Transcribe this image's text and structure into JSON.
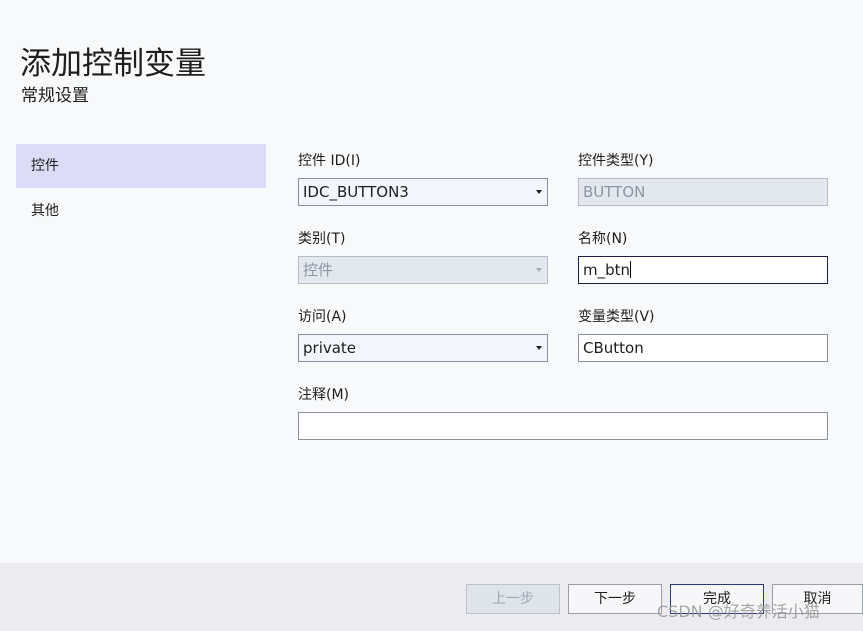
{
  "header": {
    "title": "添加控制变量",
    "subtitle": "常规设置"
  },
  "sidebar": {
    "items": [
      {
        "label": "控件",
        "active": true
      },
      {
        "label": "其他",
        "active": false
      }
    ]
  },
  "form": {
    "control_id": {
      "label": "控件 ID(I)",
      "value": "IDC_BUTTON3"
    },
    "control_type": {
      "label": "控件类型(Y)",
      "value": "BUTTON"
    },
    "category": {
      "label": "类别(T)",
      "value": "控件"
    },
    "name": {
      "label": "名称(N)",
      "value": "m_btn"
    },
    "access": {
      "label": "访问(A)",
      "value": "private"
    },
    "variable_type": {
      "label": "变量类型(V)",
      "value": "CButton"
    },
    "comment": {
      "label": "注释(M)",
      "value": ""
    }
  },
  "footer": {
    "prev_label": "上一步",
    "next_label": "下一步",
    "finish_label": "完成",
    "cancel_label": "取消"
  },
  "watermark": "CSDN @好奇养活小猫",
  "colors": {
    "background": "#f8f9fa",
    "sidebar_active": "#dcdcf7",
    "footer": "#ececf0",
    "disabled_field": "#e3e7ee"
  }
}
